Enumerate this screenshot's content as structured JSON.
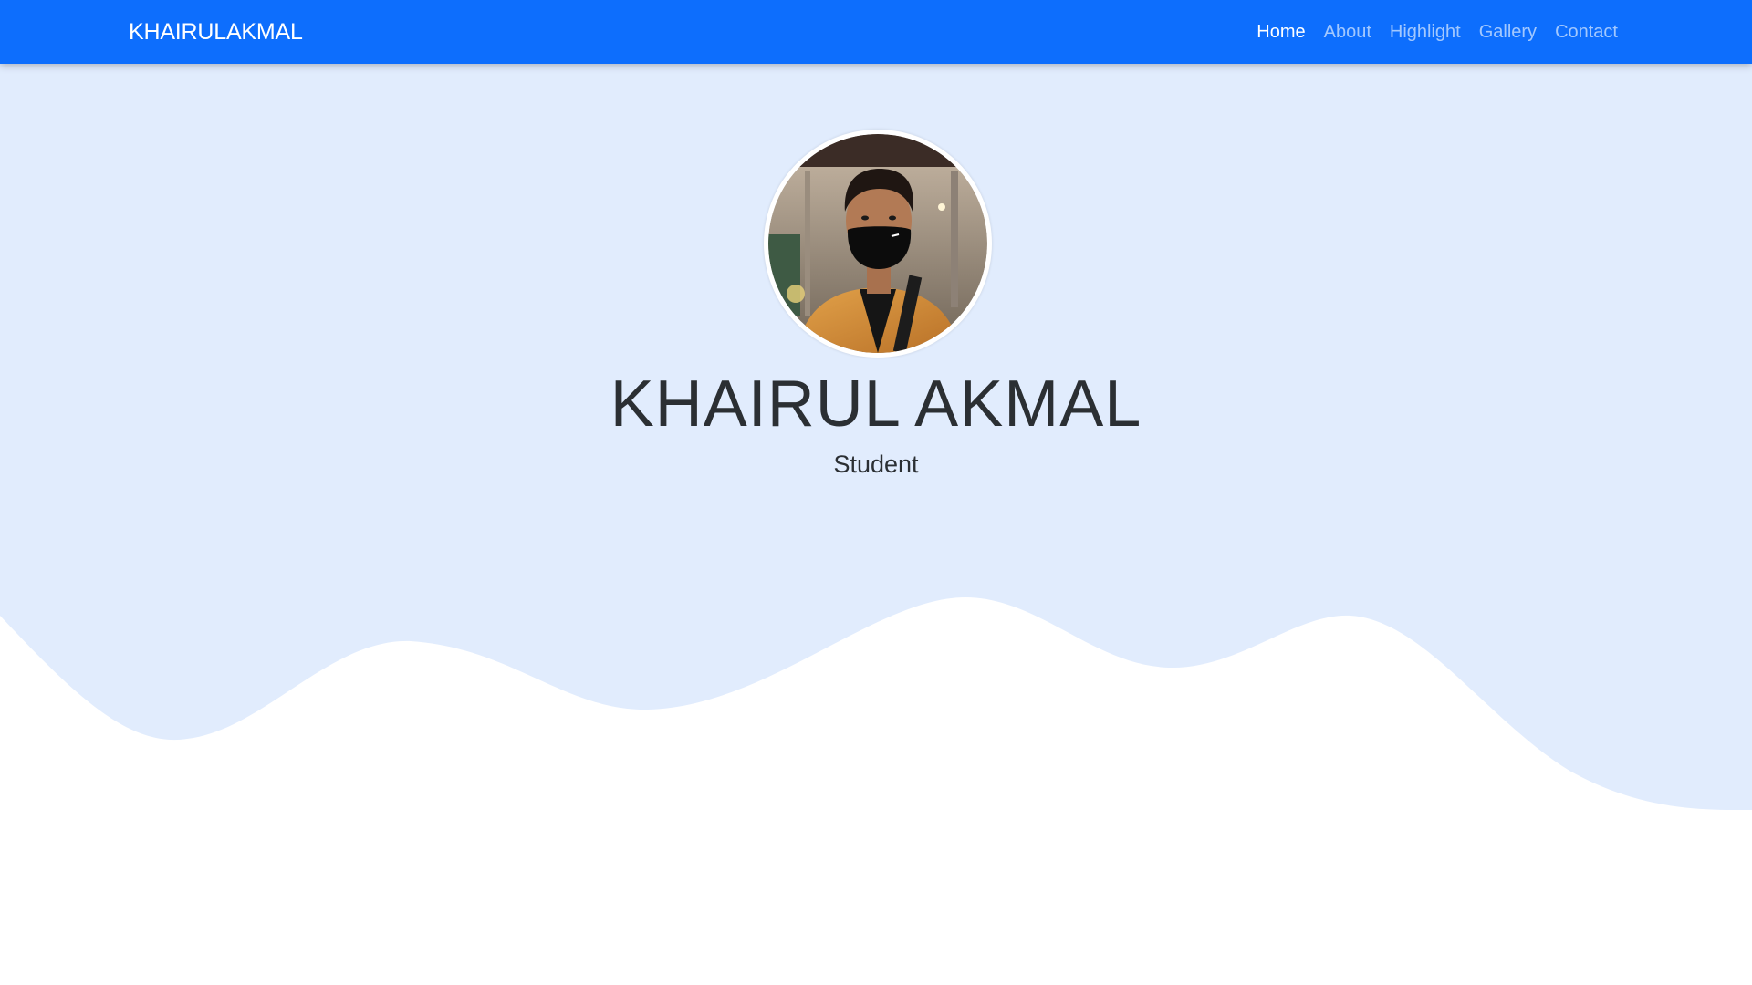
{
  "navbar": {
    "brand": "KHAIRULAKMAL",
    "links": [
      {
        "label": "Home",
        "active": true
      },
      {
        "label": "About",
        "active": false
      },
      {
        "label": "Highlight",
        "active": false
      },
      {
        "label": "Gallery",
        "active": false
      },
      {
        "label": "Contact",
        "active": false
      }
    ]
  },
  "hero": {
    "name": "KHAIRUL AKMAL",
    "role": "Student",
    "avatar_icon": "profile-photo"
  },
  "colors": {
    "navbar": "#0d6efd",
    "hero_background": "#e1ecfd",
    "wave": "#ffffff",
    "text": "#2b2f33"
  }
}
